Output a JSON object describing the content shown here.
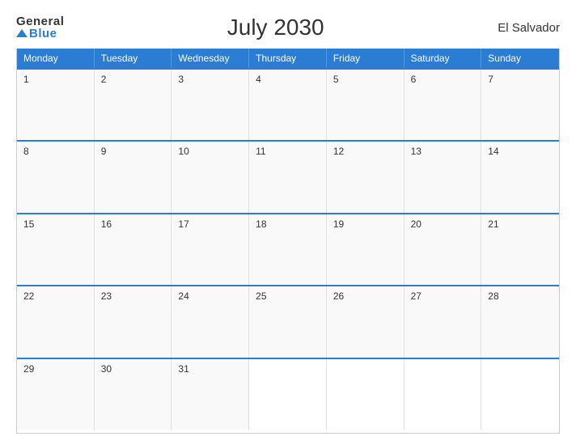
{
  "logo": {
    "general": "General",
    "blue": "Blue"
  },
  "title": "July 2030",
  "country": "El Salvador",
  "days": [
    "Monday",
    "Tuesday",
    "Wednesday",
    "Thursday",
    "Friday",
    "Saturday",
    "Sunday"
  ],
  "weeks": [
    [
      {
        "day": 1
      },
      {
        "day": 2
      },
      {
        "day": 3
      },
      {
        "day": 4
      },
      {
        "day": 5
      },
      {
        "day": 6
      },
      {
        "day": 7
      }
    ],
    [
      {
        "day": 8
      },
      {
        "day": 9
      },
      {
        "day": 10
      },
      {
        "day": 11
      },
      {
        "day": 12
      },
      {
        "day": 13
      },
      {
        "day": 14
      }
    ],
    [
      {
        "day": 15
      },
      {
        "day": 16
      },
      {
        "day": 17
      },
      {
        "day": 18
      },
      {
        "day": 19
      },
      {
        "day": 20
      },
      {
        "day": 21
      }
    ],
    [
      {
        "day": 22
      },
      {
        "day": 23
      },
      {
        "day": 24
      },
      {
        "day": 25
      },
      {
        "day": 26
      },
      {
        "day": 27
      },
      {
        "day": 28
      }
    ],
    [
      {
        "day": 29
      },
      {
        "day": 30
      },
      {
        "day": 31
      },
      {
        "day": ""
      },
      {
        "day": ""
      },
      {
        "day": ""
      },
      {
        "day": ""
      }
    ]
  ]
}
